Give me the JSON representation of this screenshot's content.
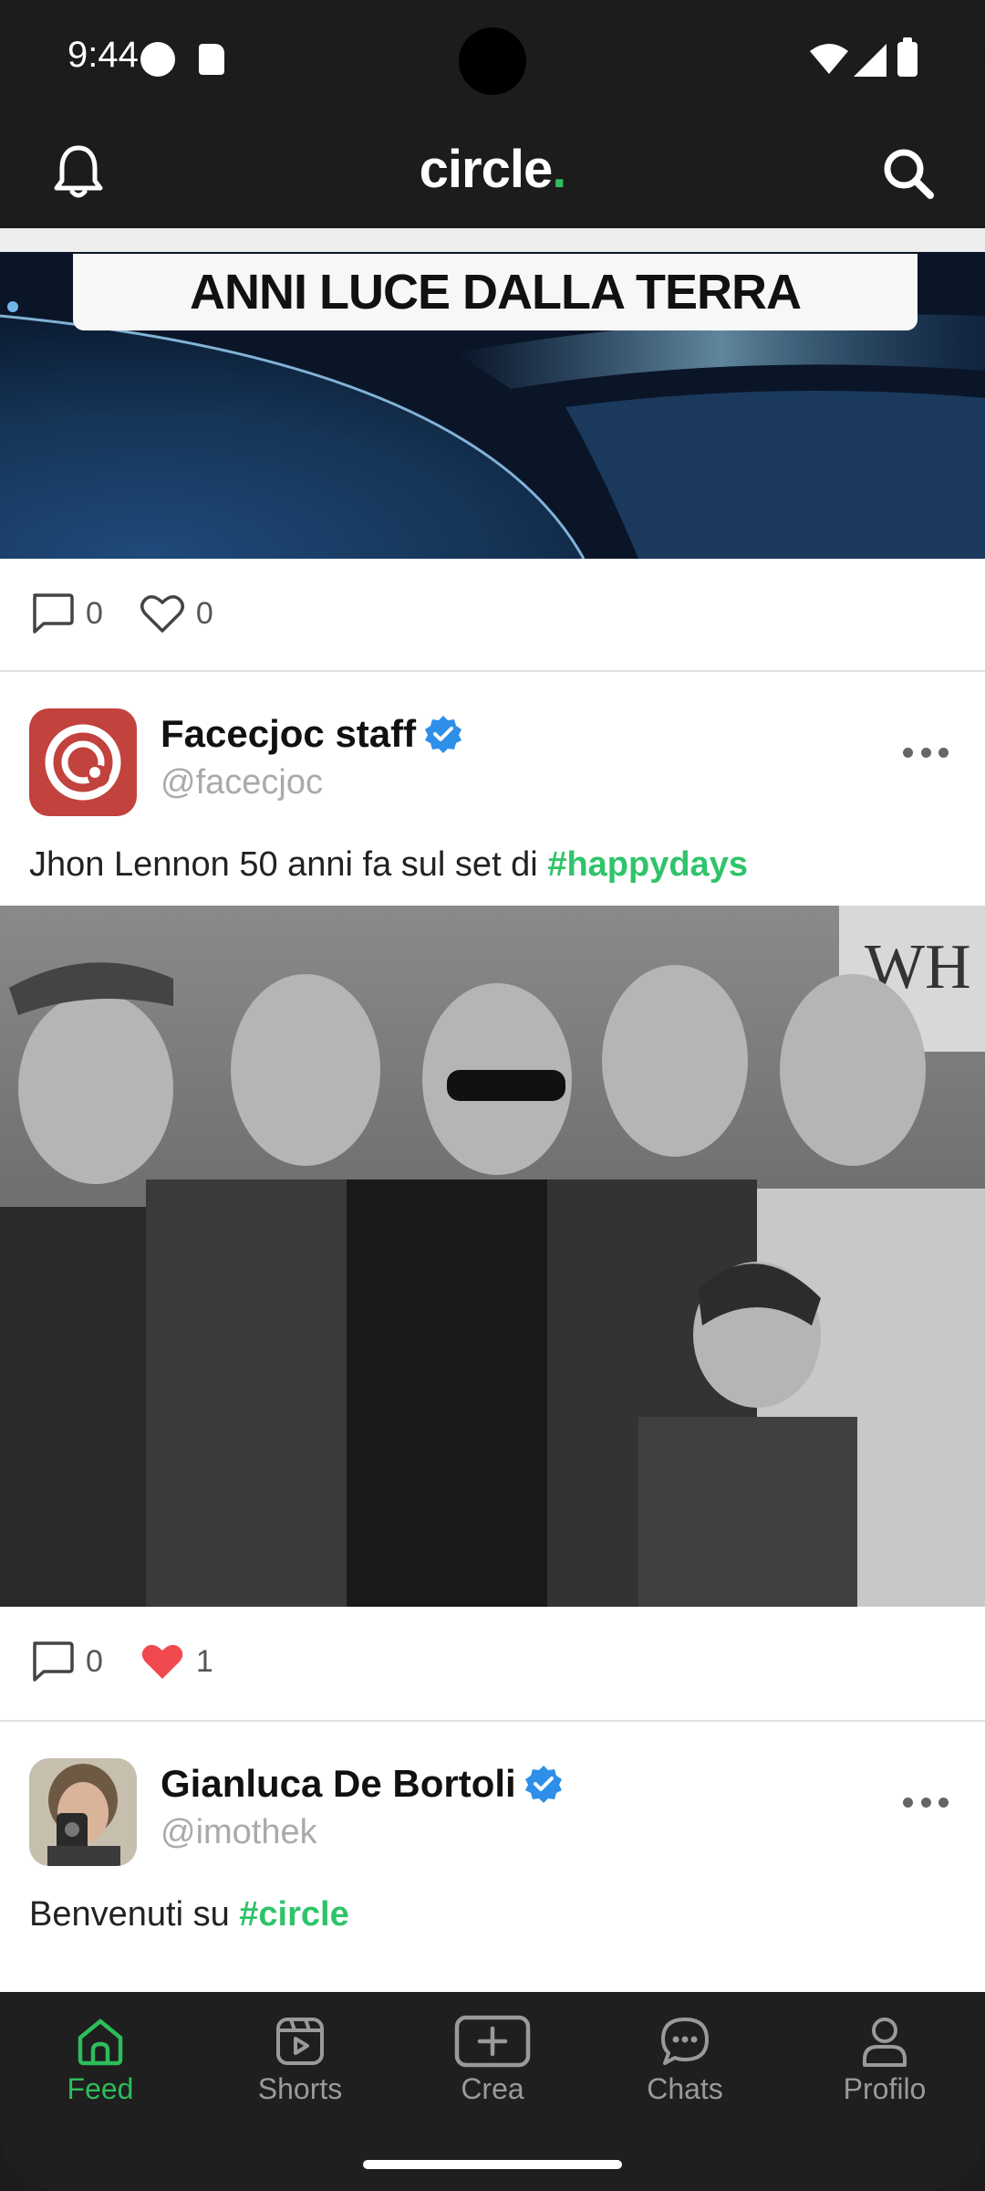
{
  "status_bar": {
    "time": "9:44"
  },
  "app_header": {
    "logo_text": "circle",
    "logo_dot": ".",
    "accent_color": "#2dbd5a"
  },
  "feed": {
    "post0": {
      "banner_text": "ANNI LUCE DALLA TERRA",
      "comments": "0",
      "likes": "0",
      "liked": false
    },
    "post1": {
      "user_name": "Facecjoc staff",
      "handle": "@facecjoc",
      "text": "Jhon Lennon 50 anni fa sul set di ",
      "hashtag": "#happydays",
      "comments": "0",
      "likes": "1",
      "liked": true
    },
    "post2": {
      "user_name": "Gianluca De Bortoli",
      "handle": "@imothek",
      "text": "Benvenuti su ",
      "hashtag": "#circle"
    }
  },
  "bottom_nav": {
    "items": [
      {
        "label": "Feed",
        "icon": "home-icon",
        "active": true
      },
      {
        "label": "Shorts",
        "icon": "play-icon",
        "active": false
      },
      {
        "label": "Crea",
        "icon": "add-icon",
        "active": false
      },
      {
        "label": "Chats",
        "icon": "chat-icon",
        "active": false
      },
      {
        "label": "Profilo",
        "icon": "user-icon",
        "active": false
      }
    ]
  }
}
